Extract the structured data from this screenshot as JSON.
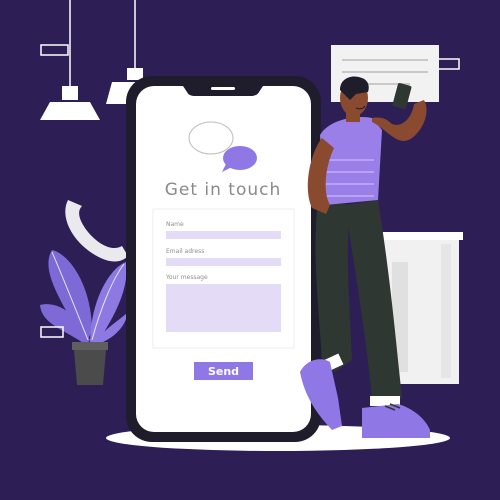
{
  "form": {
    "title": "Get in touch",
    "name_label": "Name",
    "email_label": "Email adress",
    "message_label": "Your message",
    "send_label": "Send"
  },
  "colors": {
    "background": "#2d1f56",
    "accent": "#8f78e6",
    "field": "#e4dcf6",
    "phone_frame": "#1f1d2b",
    "phone_screen": "#ffffff"
  },
  "icons": [
    "phone-handset-icon",
    "chat-bubble-icon"
  ]
}
